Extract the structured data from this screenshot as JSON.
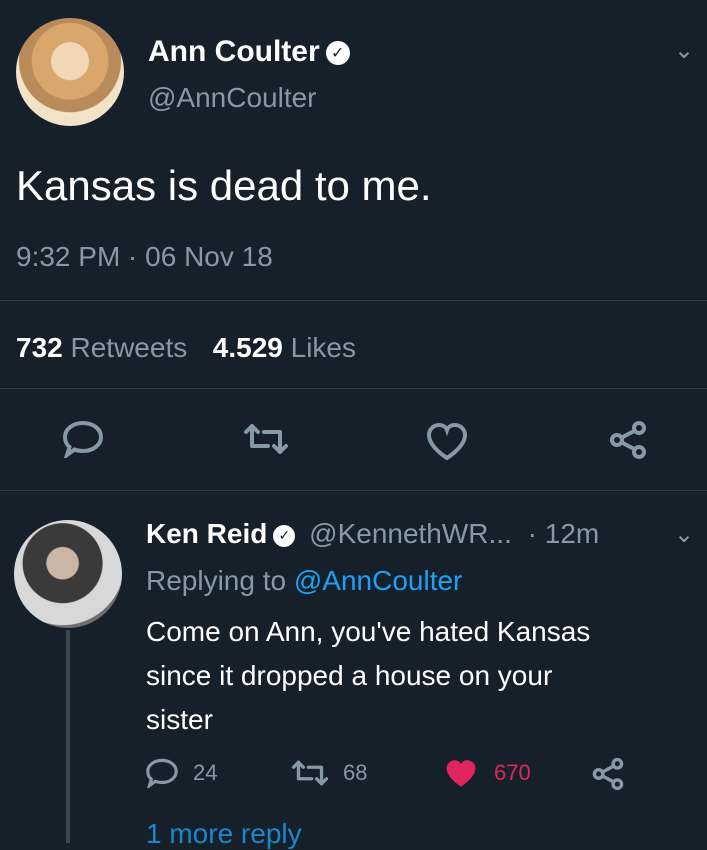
{
  "tweet": {
    "display_name": "Ann Coulter",
    "handle": "@AnnCoulter",
    "text": "Kansas is dead to me.",
    "timestamp": "9:32 PM · 06 Nov 18",
    "stats": {
      "retweets_count": "732",
      "retweets_label": "Retweets",
      "likes_count": "4.529",
      "likes_label": "Likes"
    }
  },
  "reply": {
    "display_name": "Ken Reid",
    "handle": "@KennethWR...",
    "time": "· 12m",
    "replying_prefix": "Replying to",
    "replying_to": "@AnnCoulter",
    "text_line1": "Come on Ann, you've hated Kansas",
    "text_line2": "since it dropped a house on your",
    "text_line3": "sister",
    "counts": {
      "replies": "24",
      "retweets": "68",
      "likes": "670"
    },
    "more_replies": "1 more reply"
  },
  "icons": {
    "verified": "check-badge",
    "chevron": "chevron-down",
    "reply": "speech-bubble",
    "retweet": "retweet-arrows",
    "like": "heart",
    "share": "share-nodes"
  },
  "colors": {
    "background": "#15202b",
    "muted": "#8899a6",
    "link": "#1da1f2",
    "like": "#e0245e"
  }
}
